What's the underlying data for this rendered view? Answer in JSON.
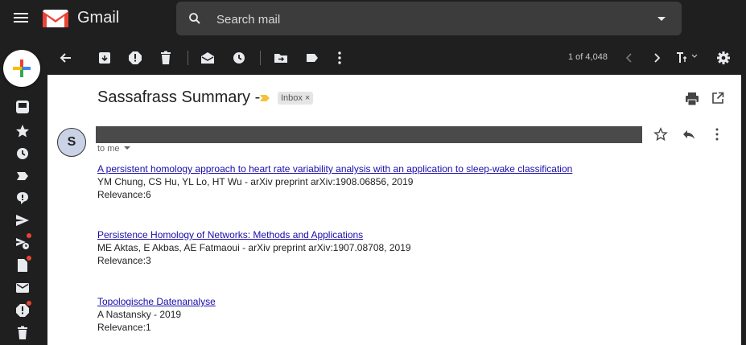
{
  "header": {
    "brand": "Gmail",
    "search_placeholder": "Search mail",
    "colors": {
      "gmail_red": "#ea4335",
      "dark_bg": "#1f1f1f",
      "search_bg": "#3c3c3c"
    }
  },
  "sidebar": {
    "items": [
      {
        "icon": "inbox-icon",
        "active": true
      },
      {
        "icon": "star-icon"
      },
      {
        "icon": "clock-icon"
      },
      {
        "icon": "important-label-icon"
      },
      {
        "icon": "chat-icon"
      },
      {
        "icon": "send-icon"
      },
      {
        "icon": "scheduled-icon",
        "badge": true
      },
      {
        "icon": "drafts-icon",
        "badge": true
      },
      {
        "icon": "mail-icon"
      },
      {
        "icon": "spam-icon",
        "badge": true
      },
      {
        "icon": "trash-icon"
      }
    ]
  },
  "toolbar": {
    "pager": "1 of 4,048",
    "icons": [
      "back-arrow-icon",
      "archive-icon",
      "report-spam-icon",
      "delete-icon",
      "mark-unread-icon",
      "snooze-icon",
      "move-to-icon",
      "label-icon",
      "more-vert-icon",
      "prev-icon",
      "next-icon",
      "input-tools-icon",
      "settings-icon"
    ]
  },
  "message": {
    "subject": "Sassafrass Summary -",
    "chip_label": "Inbox",
    "chip_close": "×",
    "avatar_initial": "S",
    "to_line": "to me",
    "results": [
      {
        "title": "A persistent homology approach to heart rate variability analysis with an application to sleep-wake classification",
        "meta": "YM Chung, CS Hu, YL Lo, HT Wu - arXiv preprint arXiv:1908.06856, 2019",
        "relevance": "Relevance:6"
      },
      {
        "title": "Persistence Homology of Networks: Methods and Applications",
        "meta": "ME Aktas, E Akbas, AE Fatmaoui - arXiv preprint arXiv:1907.08708, 2019",
        "relevance": "Relevance:3"
      },
      {
        "title": "Topologische Datenanalyse",
        "meta": "A Nastansky - 2019",
        "relevance": "Relevance:1"
      }
    ]
  }
}
